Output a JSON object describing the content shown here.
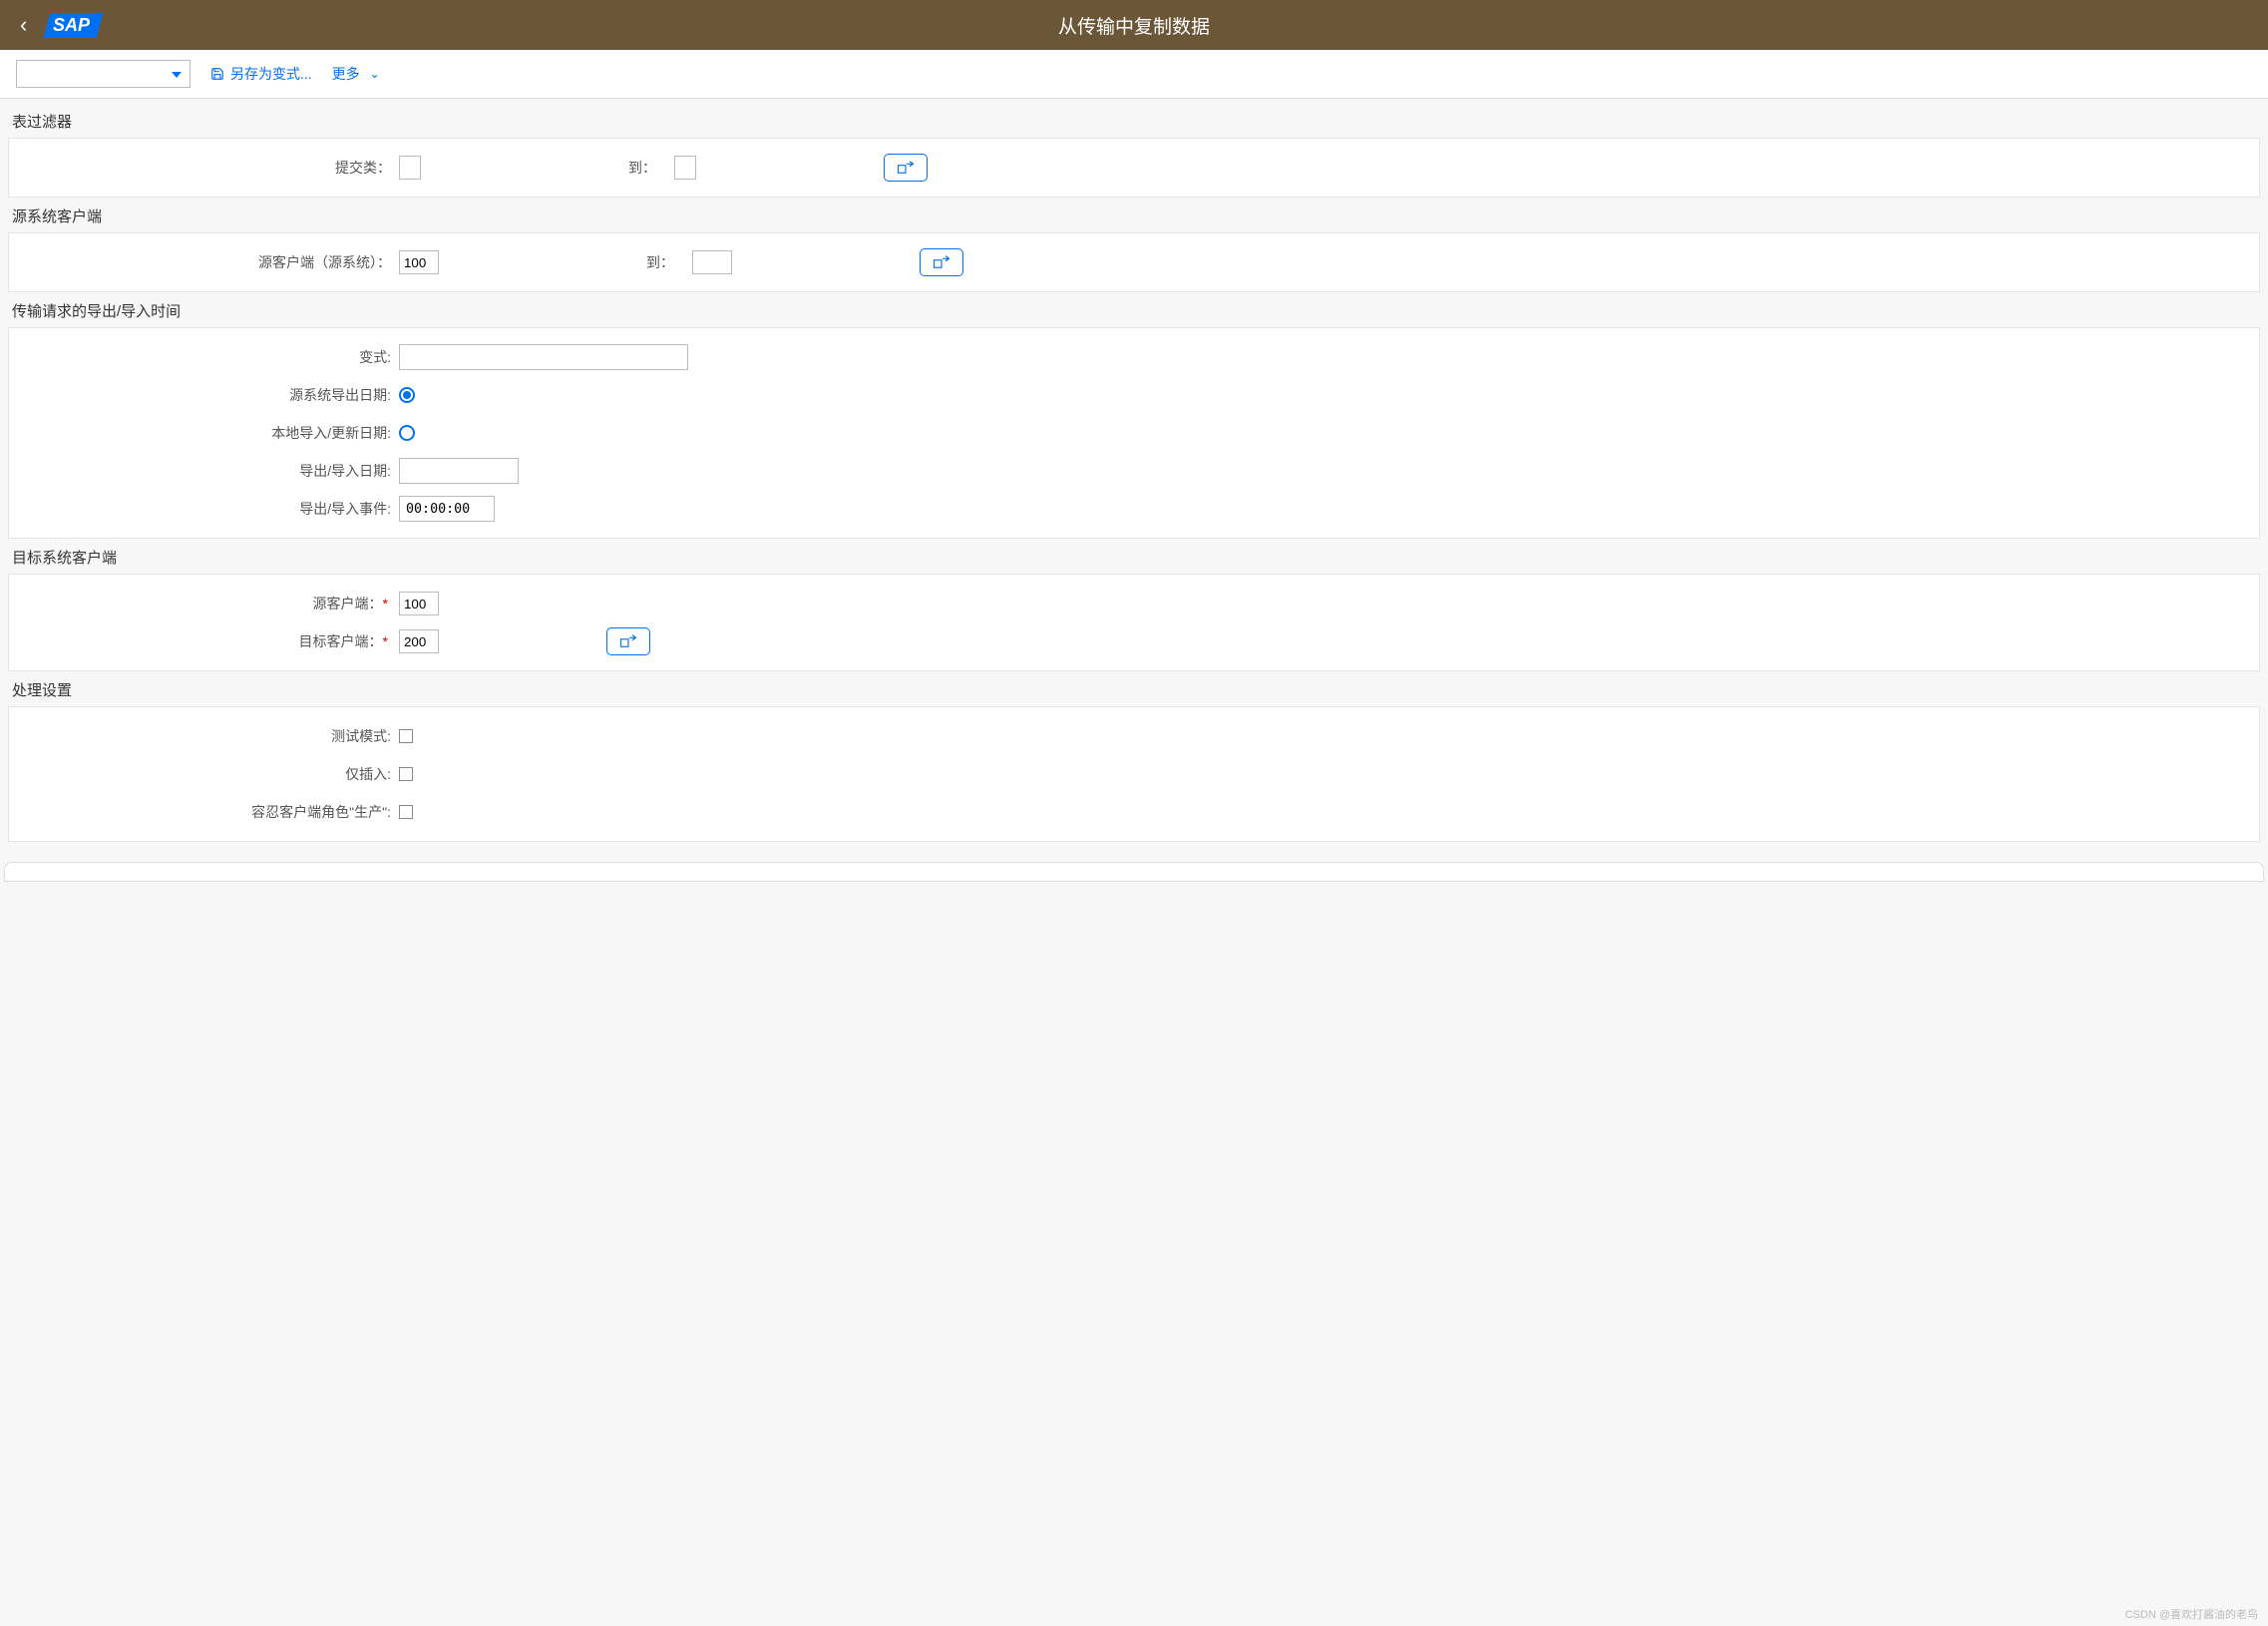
{
  "header": {
    "title": "从传输中复制数据"
  },
  "toolbar": {
    "save_as_variant": "另存为变式...",
    "more": "更多"
  },
  "sections": {
    "table_filter": {
      "title": "表过滤器",
      "submit_type_label": "提交类：",
      "to_label": "到："
    },
    "source_client": {
      "title": "源系统客户端",
      "source_client_label": "源客户端（源系统）：",
      "source_client_value": "100",
      "to_label": "到："
    },
    "transport_time": {
      "title": "传输请求的导出/导入时间",
      "variant_label": "变式:",
      "export_date_label": "源系统导出日期:",
      "local_import_label": "本地导入/更新日期:",
      "export_import_date_label": "导出/导入日期:",
      "export_import_event_label": "导出/导入事件:",
      "event_value": "00:00:00"
    },
    "target_client": {
      "title": "目标系统客户端",
      "source_client_label": "源客户端：",
      "source_client_value": "100",
      "target_client_label": "目标客户端：",
      "target_client_value": "200"
    },
    "processing": {
      "title": "处理设置",
      "test_mode_label": "测试模式:",
      "insert_only_label": "仅插入:",
      "tolerate_prod_label": "容忍客户端角色\"生产\":"
    }
  },
  "watermark": "CSDN @喜欢打酱油的老鸟"
}
